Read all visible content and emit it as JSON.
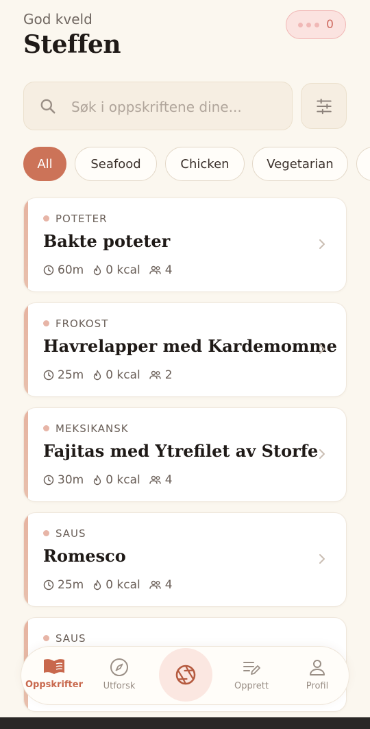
{
  "header": {
    "greeting": "God kveld",
    "username": "Steffen",
    "badge_count": "0"
  },
  "search": {
    "placeholder": "Søk i oppskriftene dine..."
  },
  "chips": [
    "All",
    "Seafood",
    "Chicken",
    "Vegetarian"
  ],
  "recipes": [
    {
      "category": "POTETER",
      "title": "Bakte poteter",
      "time": "60m",
      "kcal": "0 kcal",
      "servings": "4"
    },
    {
      "category": "FROKOST",
      "title": "Havrelapper med Kardemomme",
      "time": "25m",
      "kcal": "0 kcal",
      "servings": "2"
    },
    {
      "category": "MEKSIKANSK",
      "title": "Fajitas med Ytrefilet av Storfe",
      "time": "30m",
      "kcal": "0 kcal",
      "servings": "4"
    },
    {
      "category": "SAUS",
      "title": "Romesco",
      "time": "25m",
      "kcal": "0 kcal",
      "servings": "4"
    },
    {
      "category": "SAUS"
    }
  ],
  "tabs": [
    {
      "label": "Oppskrifter",
      "icon": "book-icon"
    },
    {
      "label": "Utforsk",
      "icon": "compass-icon"
    },
    {
      "label": "",
      "icon": "camera-shutter-icon"
    },
    {
      "label": "Opprett",
      "icon": "edit-list-icon"
    },
    {
      "label": "Profil",
      "icon": "user-icon"
    }
  ],
  "colors": {
    "accent": "#cc7358",
    "background": "#fbf7ef"
  }
}
